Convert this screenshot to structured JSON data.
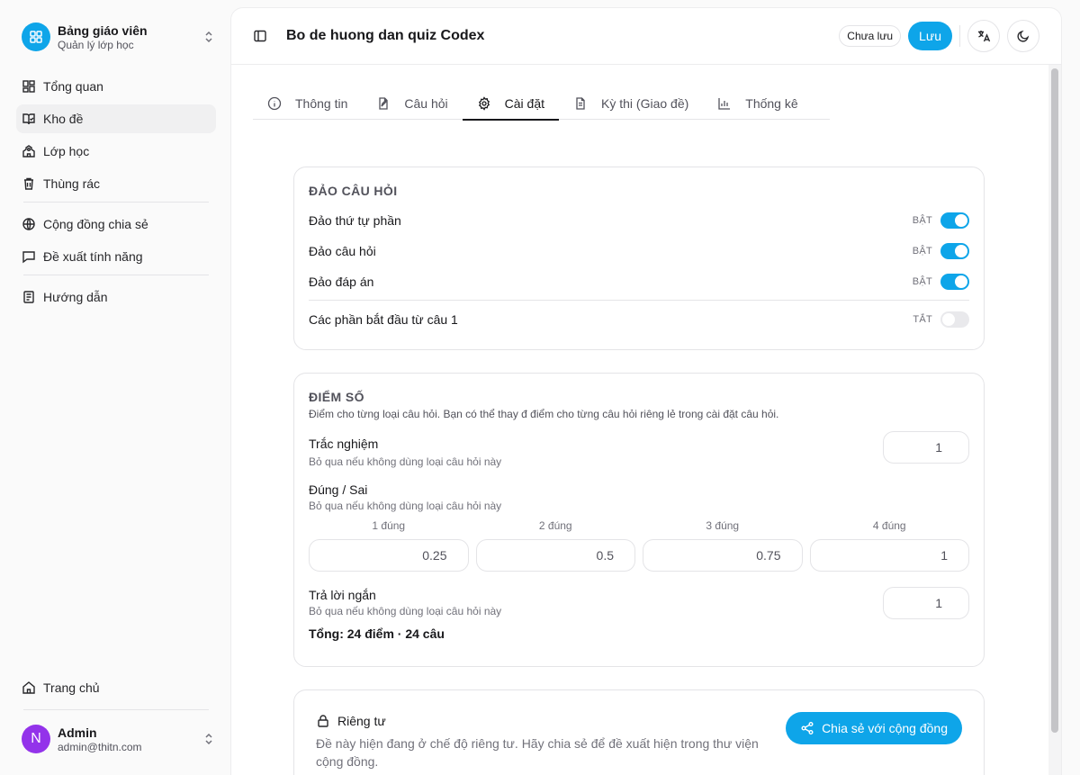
{
  "brand": {
    "title": "Bảng giáo viên",
    "subtitle": "Quản lý lớp học"
  },
  "nav": {
    "overview": "Tổng quan",
    "repository": "Kho đề",
    "classes": "Lớp học",
    "trash": "Thùng rác",
    "community": "Cộng đồng chia sẻ",
    "feature_request": "Đề xuất tính năng",
    "guide": "Hướng dẫn",
    "home": "Trang chủ"
  },
  "user": {
    "name": "Admin",
    "email": "admin@thitn.com",
    "initial": "N"
  },
  "header": {
    "title": "Bo de huong dan quiz Codex",
    "status_badge": "Chưa lưu",
    "save_label": "Lưu"
  },
  "tabs": {
    "info": "Thông tin",
    "questions": "Câu hỏi",
    "settings": "Cài đặt",
    "exams": "Kỳ thi (Giao đề)",
    "stats": "Thống kê"
  },
  "shuffle": {
    "title": "Đảo câu hỏi",
    "rows": [
      {
        "label": "Đảo thứ tự phần",
        "state": "BẬT",
        "on": true
      },
      {
        "label": "Đảo câu hỏi",
        "state": "BẬT",
        "on": true
      },
      {
        "label": "Đảo đáp án",
        "state": "BẬT",
        "on": true
      },
      {
        "label": "Các phần bắt đầu từ câu 1",
        "state": "TẮT",
        "on": false
      }
    ]
  },
  "scoring": {
    "title": "Điểm số",
    "description": "Điểm cho từng loại câu hỏi. Bạn có thể thay đ điểm cho từng câu hỏi riêng lẻ trong cài đặt câu hỏi.",
    "mcq": {
      "label": "Trắc nghiệm",
      "help": "Bỏ qua nếu không dùng loại câu hỏi này",
      "value": "1"
    },
    "tf": {
      "label": "Đúng / Sai",
      "help": "Bỏ qua nếu không dùng loại câu hỏi này",
      "cols": [
        {
          "head": "1 đúng",
          "value": "0.25"
        },
        {
          "head": "2 đúng",
          "value": "0.5"
        },
        {
          "head": "3 đúng",
          "value": "0.75"
        },
        {
          "head": "4 đúng",
          "value": "1"
        }
      ]
    },
    "short": {
      "label": "Trả lời ngắn",
      "help": "Bỏ qua nếu không dùng loại câu hỏi này",
      "value": "1"
    },
    "total": "Tổng: 24 điểm · 24 câu"
  },
  "privacy": {
    "title": "Riêng tư",
    "description": "Đề này hiện đang ở chế độ riêng tư. Hãy chia sẻ để đề xuất hiện trong thư viện cộng đồng.",
    "share_label": "Chia sẻ với cộng đồng"
  },
  "colors": {
    "accent": "#0ea5e9",
    "avatar": "#9333ea"
  }
}
